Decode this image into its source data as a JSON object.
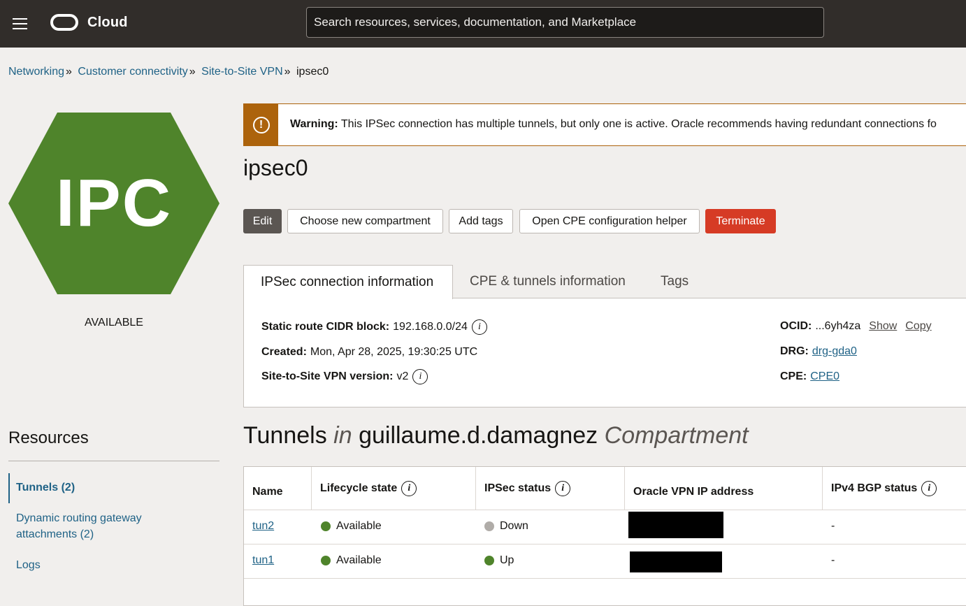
{
  "header": {
    "logo_text": "Cloud",
    "search_placeholder": "Search resources, services, documentation, and Marketplace"
  },
  "breadcrumb": {
    "items": [
      "Networking",
      "Customer connectivity",
      "Site-to-Site VPN"
    ],
    "current": "ipsec0",
    "separator": "»"
  },
  "resource_badge": {
    "text": "IPC",
    "color": "#4f842b",
    "status": "AVAILABLE"
  },
  "warning": {
    "label": "Warning:",
    "message": "This IPSec connection has multiple tunnels, but only one is active. Oracle recommends having redundant connections fo"
  },
  "page_title": "ipsec0",
  "actions": {
    "edit": "Edit",
    "choose_compartment": "Choose new compartment",
    "add_tags": "Add tags",
    "open_cpe_helper": "Open CPE configuration helper",
    "terminate": "Terminate"
  },
  "tabs": [
    "IPSec connection information",
    "CPE & tunnels information",
    "Tags"
  ],
  "info": {
    "static_route_label": "Static route CIDR block:",
    "static_route_value": "192.168.0.0/24",
    "created_label": "Created:",
    "created_value": "Mon, Apr 28, 2025, 19:30:25 UTC",
    "vpn_version_label": "Site-to-Site VPN version:",
    "vpn_version_value": "v2",
    "ocid_label": "OCID:",
    "ocid_value": "...6yh4za",
    "show": "Show",
    "copy": "Copy",
    "drg_label": "DRG:",
    "drg_value": "drg-gda0",
    "cpe_label": "CPE:",
    "cpe_value": "CPE0"
  },
  "resources": {
    "title": "Resources",
    "items": [
      "Tunnels (2)",
      "Dynamic routing gateway",
      "attachments (2)",
      "Logs"
    ]
  },
  "tunnels": {
    "title_main": "Tunnels",
    "title_in": "in",
    "compartment": "guillaume.d.damagnez",
    "title_suffix": "Compartment",
    "columns": [
      "Name",
      "Lifecycle state",
      "IPSec status",
      "Oracle VPN IP address",
      "IPv4 BGP status"
    ],
    "rows": [
      {
        "name": "tun2",
        "lifecycle": "Available",
        "ipsec": "Down",
        "bgp": "-"
      },
      {
        "name": "tun1",
        "lifecycle": "Available",
        "ipsec": "Up",
        "bgp": "-"
      }
    ],
    "colors": {
      "available": "#4f842b",
      "down": "#b0aca8",
      "up": "#4f842b"
    }
  },
  "info_icon": "i"
}
